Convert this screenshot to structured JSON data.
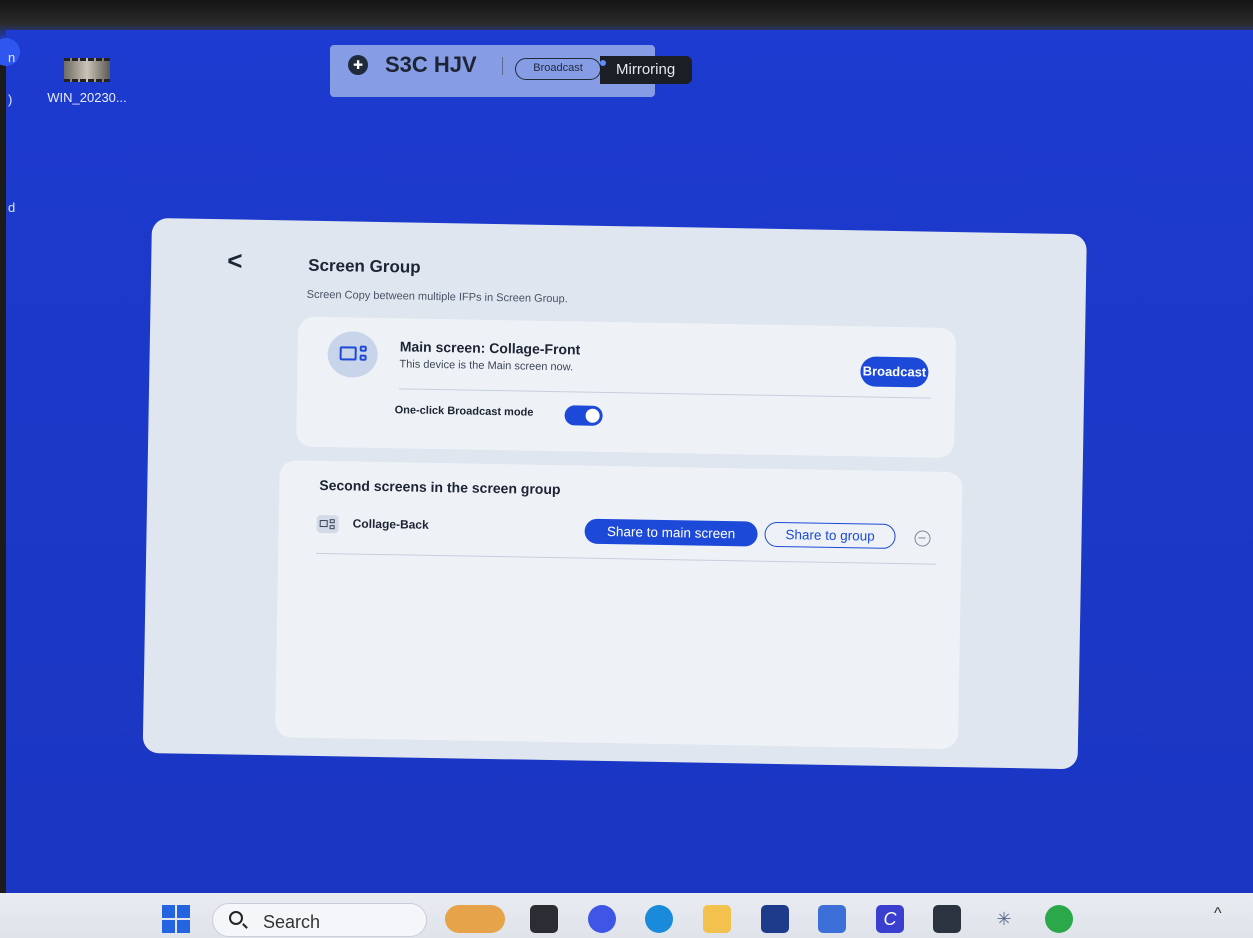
{
  "desktop": {
    "icon_label": "WIN_20230...",
    "left_edge_texts": [
      "n",
      ")",
      "d"
    ]
  },
  "topbar": {
    "device_name": "S3C HJV",
    "broadcast_chip": "Broadcast",
    "mirroring_label": "Mirroring"
  },
  "panel": {
    "back_icon": "chevron-left-icon",
    "title": "Screen Group",
    "subtitle": "Screen Copy between multiple IFPs in Screen Group.",
    "main_card": {
      "title": "Main screen: Collage-Front",
      "subtitle": "This device is the Main screen now.",
      "broadcast_button": "Broadcast",
      "one_click_label": "One-click Broadcast mode",
      "one_click_enabled": true
    },
    "second_card": {
      "title": "Second screens in the screen group",
      "devices": [
        {
          "name": "Collage-Back",
          "share_main_label": "Share to main screen",
          "share_group_label": "Share to group"
        }
      ]
    }
  },
  "taskbar": {
    "search_placeholder": "Search",
    "apps": [
      "pizza-app-icon",
      "terminal-icon",
      "zoom-icon",
      "edge-icon",
      "file-explorer-icon",
      "store-icon",
      "keyboard-app-icon",
      "canva-icon",
      "camera-icon",
      "snowflake-icon",
      "screen-share-icon"
    ],
    "colors": {
      "accent": "#1d49d8",
      "desktop": "#1c38c8"
    }
  }
}
